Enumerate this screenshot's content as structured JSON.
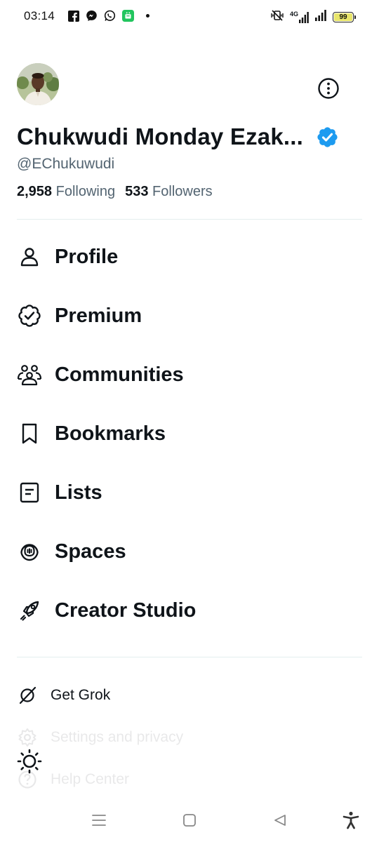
{
  "status_bar": {
    "time": "03:14",
    "network": "4G",
    "battery": "99",
    "battery_level": 0.99,
    "app_icons": [
      "facebook-icon",
      "messenger-icon",
      "whatsapp-icon",
      "android-app-icon"
    ]
  },
  "profile": {
    "name": "Chukwudi Monday Ezak...",
    "handle": "@EChukuwudi",
    "following_count": "2,958",
    "following_label": "Following",
    "followers_count": "533",
    "followers_label": "Followers",
    "verified_color": "#1d9bf0"
  },
  "menu": {
    "items": [
      {
        "label": "Profile",
        "icon": "person-icon"
      },
      {
        "label": "Premium",
        "icon": "verified-badge-icon"
      },
      {
        "label": "Communities",
        "icon": "communities-icon"
      },
      {
        "label": "Bookmarks",
        "icon": "bookmark-icon"
      },
      {
        "label": "Lists",
        "icon": "list-icon"
      },
      {
        "label": "Spaces",
        "icon": "spaces-icon"
      },
      {
        "label": "Creator Studio",
        "icon": "rocket-icon"
      }
    ]
  },
  "secondary": {
    "items": [
      {
        "label": "Get Grok",
        "icon": "grok-icon"
      },
      {
        "label": "Settings and privacy",
        "icon": "gear-icon"
      },
      {
        "label": "Help Center",
        "icon": "help-icon"
      }
    ]
  },
  "theme_toggle": {
    "icon": "sun-icon"
  },
  "navigation_bar": {
    "icons": [
      "menu-icon",
      "home-square-icon",
      "back-triangle-icon",
      "accessibility-icon"
    ]
  }
}
